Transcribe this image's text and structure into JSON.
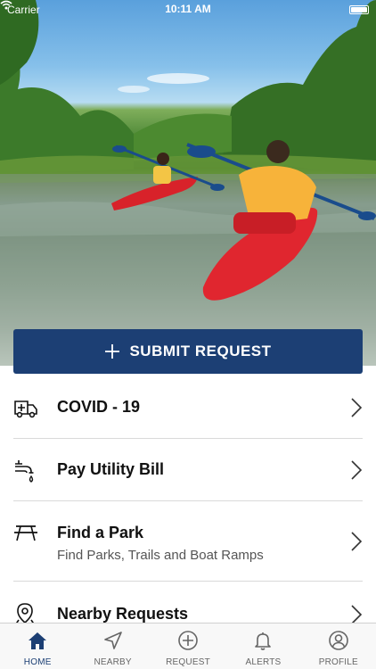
{
  "status_bar": {
    "carrier": "Carrier",
    "time": "10:11 AM"
  },
  "hero": {
    "description_icon": "kayak-photo"
  },
  "submit_button": {
    "label": "SUBMIT REQUEST",
    "icon": "plus-icon"
  },
  "menu": {
    "items": [
      {
        "title": "COVID - 19",
        "subtitle": "",
        "icon": "ambulance-icon"
      },
      {
        "title": "Pay Utility Bill",
        "subtitle": "",
        "icon": "faucet-icon"
      },
      {
        "title": "Find a Park",
        "subtitle": "Find Parks, Trails and Boat Ramps",
        "icon": "picnic-table-icon"
      },
      {
        "title": "Nearby Requests",
        "subtitle": "",
        "icon": "map-pin-icon"
      }
    ]
  },
  "tab_bar": {
    "tabs": [
      {
        "label": "HOME",
        "icon": "home-icon",
        "active": true
      },
      {
        "label": "NEARBY",
        "icon": "navigation-arrow-icon",
        "active": false
      },
      {
        "label": "REQUEST",
        "icon": "plus-circle-icon",
        "active": false
      },
      {
        "label": "ALERTS",
        "icon": "bell-icon",
        "active": false
      },
      {
        "label": "PROFILE",
        "icon": "user-circle-icon",
        "active": false
      }
    ]
  },
  "colors": {
    "primary": "#1c3f74",
    "divider": "#d9d9d9",
    "tab_inactive": "#666666"
  }
}
